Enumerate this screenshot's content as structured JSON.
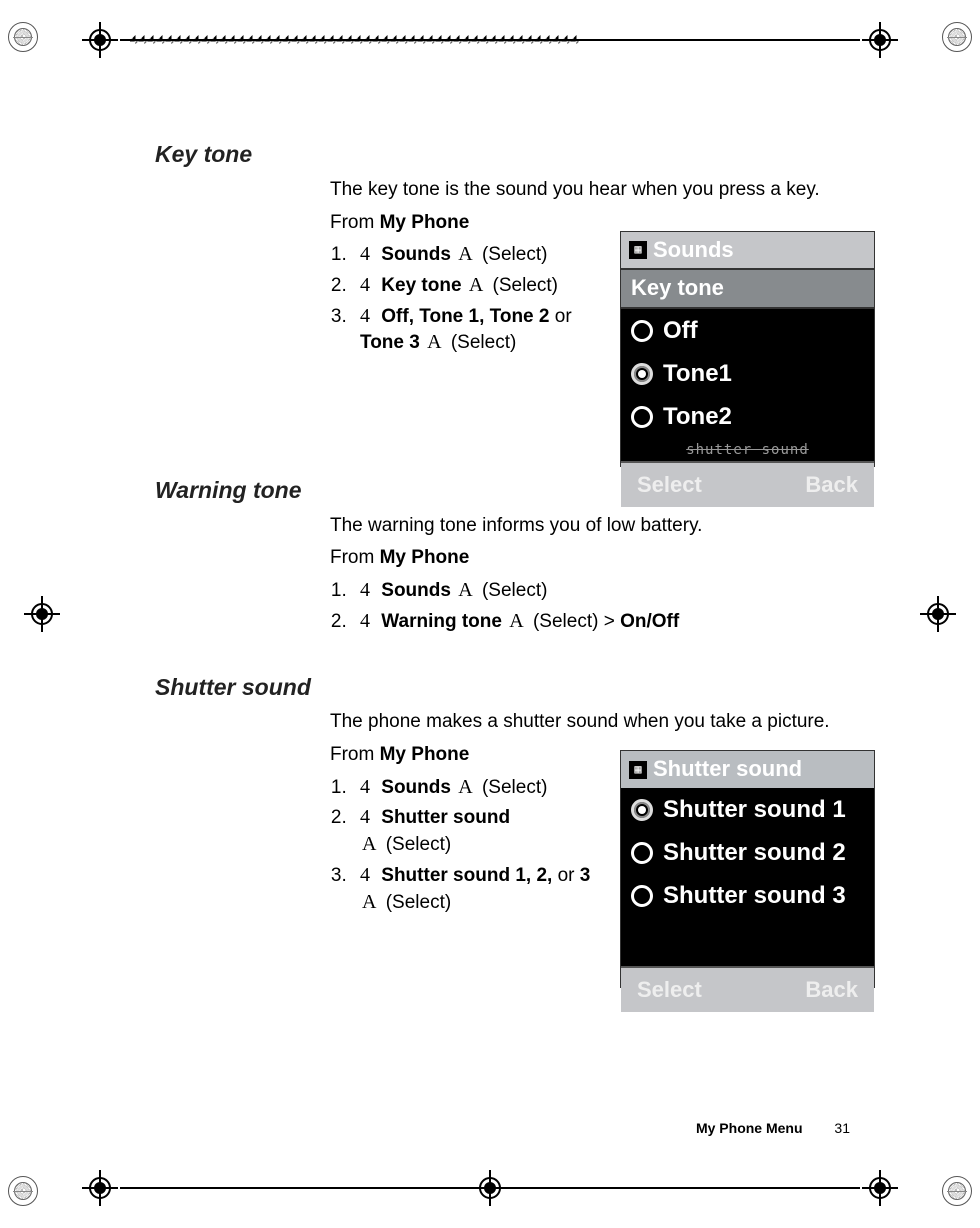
{
  "sections": {
    "key_tone": {
      "heading": "Key tone",
      "intro": "The key tone is the sound you hear when you press a key.",
      "from_prefix": "From ",
      "from_bold": "My Phone",
      "steps": [
        {
          "action": "Sounds",
          "select": "(Select)"
        },
        {
          "action": "Key tone",
          "select": "(Select)"
        },
        {
          "action": "Off, Tone 1, Tone 2",
          "connector": " or ",
          "action2": "Tone 3",
          "select": "(Select)"
        }
      ]
    },
    "warning_tone": {
      "heading": "Warning tone",
      "intro": "The warning tone informs you of low battery.",
      "from_prefix": "From ",
      "from_bold": "My Phone",
      "steps": [
        {
          "action": "Sounds",
          "select": "(Select)"
        },
        {
          "action": "Warning tone",
          "select": "(Select)",
          "gt": " > ",
          "tail_bold": "On/Off"
        }
      ]
    },
    "shutter_sound": {
      "heading": "Shutter sound",
      "intro": "The phone makes a shutter sound when you take a picture.",
      "from_prefix": "From ",
      "from_bold": "My Phone",
      "steps": [
        {
          "action": "Sounds",
          "select": "(Select)"
        },
        {
          "action": "Shutter sound",
          "select": "(Select)"
        },
        {
          "action": "Shutter sound 1, 2,",
          "connector": " or ",
          "action2": "3",
          "select": "(Select)"
        }
      ]
    }
  },
  "phone1": {
    "title": "Sounds",
    "subtitle": "Key tone",
    "options": [
      "Off",
      "Tone1",
      "Tone2"
    ],
    "selected_index": 1,
    "extra": "shutter sound",
    "soft_left": "Select",
    "soft_right": "Back"
  },
  "phone3": {
    "title": "Shutter sound",
    "options": [
      "Shutter sound 1",
      "Shutter sound 2",
      "Shutter sound 3"
    ],
    "selected_index": 0,
    "soft_left": "Select",
    "soft_right": "Back"
  },
  "footer": {
    "title": "My Phone Menu",
    "page": "31"
  },
  "glyphs": {
    "nav": "4",
    "softkey": "A"
  }
}
